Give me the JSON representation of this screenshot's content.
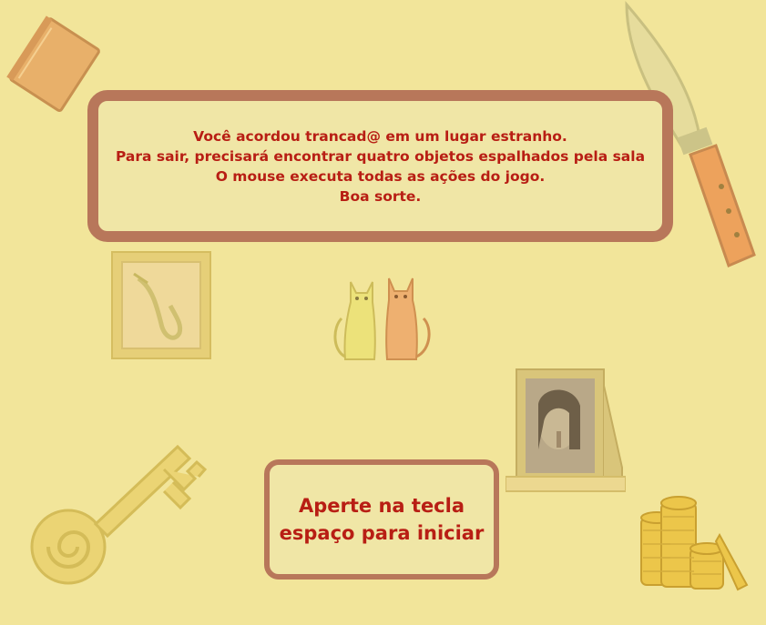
{
  "intro": {
    "lines": [
      "Você acordou trancad@ em um lugar estranho.",
      "Para sair, precisará encontrar quatro objetos espalhados pela sala",
      "O mouse executa todas as ações do jogo.",
      "Boa sorte."
    ]
  },
  "start": {
    "line1_a": "Aperte",
    "line1_b": " na tecla",
    "line2": "espaço para iniciar"
  },
  "objects": {
    "book": "book-icon",
    "knife": "knife-icon",
    "sax_frame": "saxophone-frame-icon",
    "cats": "cats-figurine-icon",
    "portrait": "portrait-frame-icon",
    "key": "key-icon",
    "coins": "coins-icon"
  },
  "colors": {
    "background": "#f2e59a",
    "box_fill": "#f0e6a6",
    "box_border": "#b8775a",
    "text": "#b81e14"
  }
}
